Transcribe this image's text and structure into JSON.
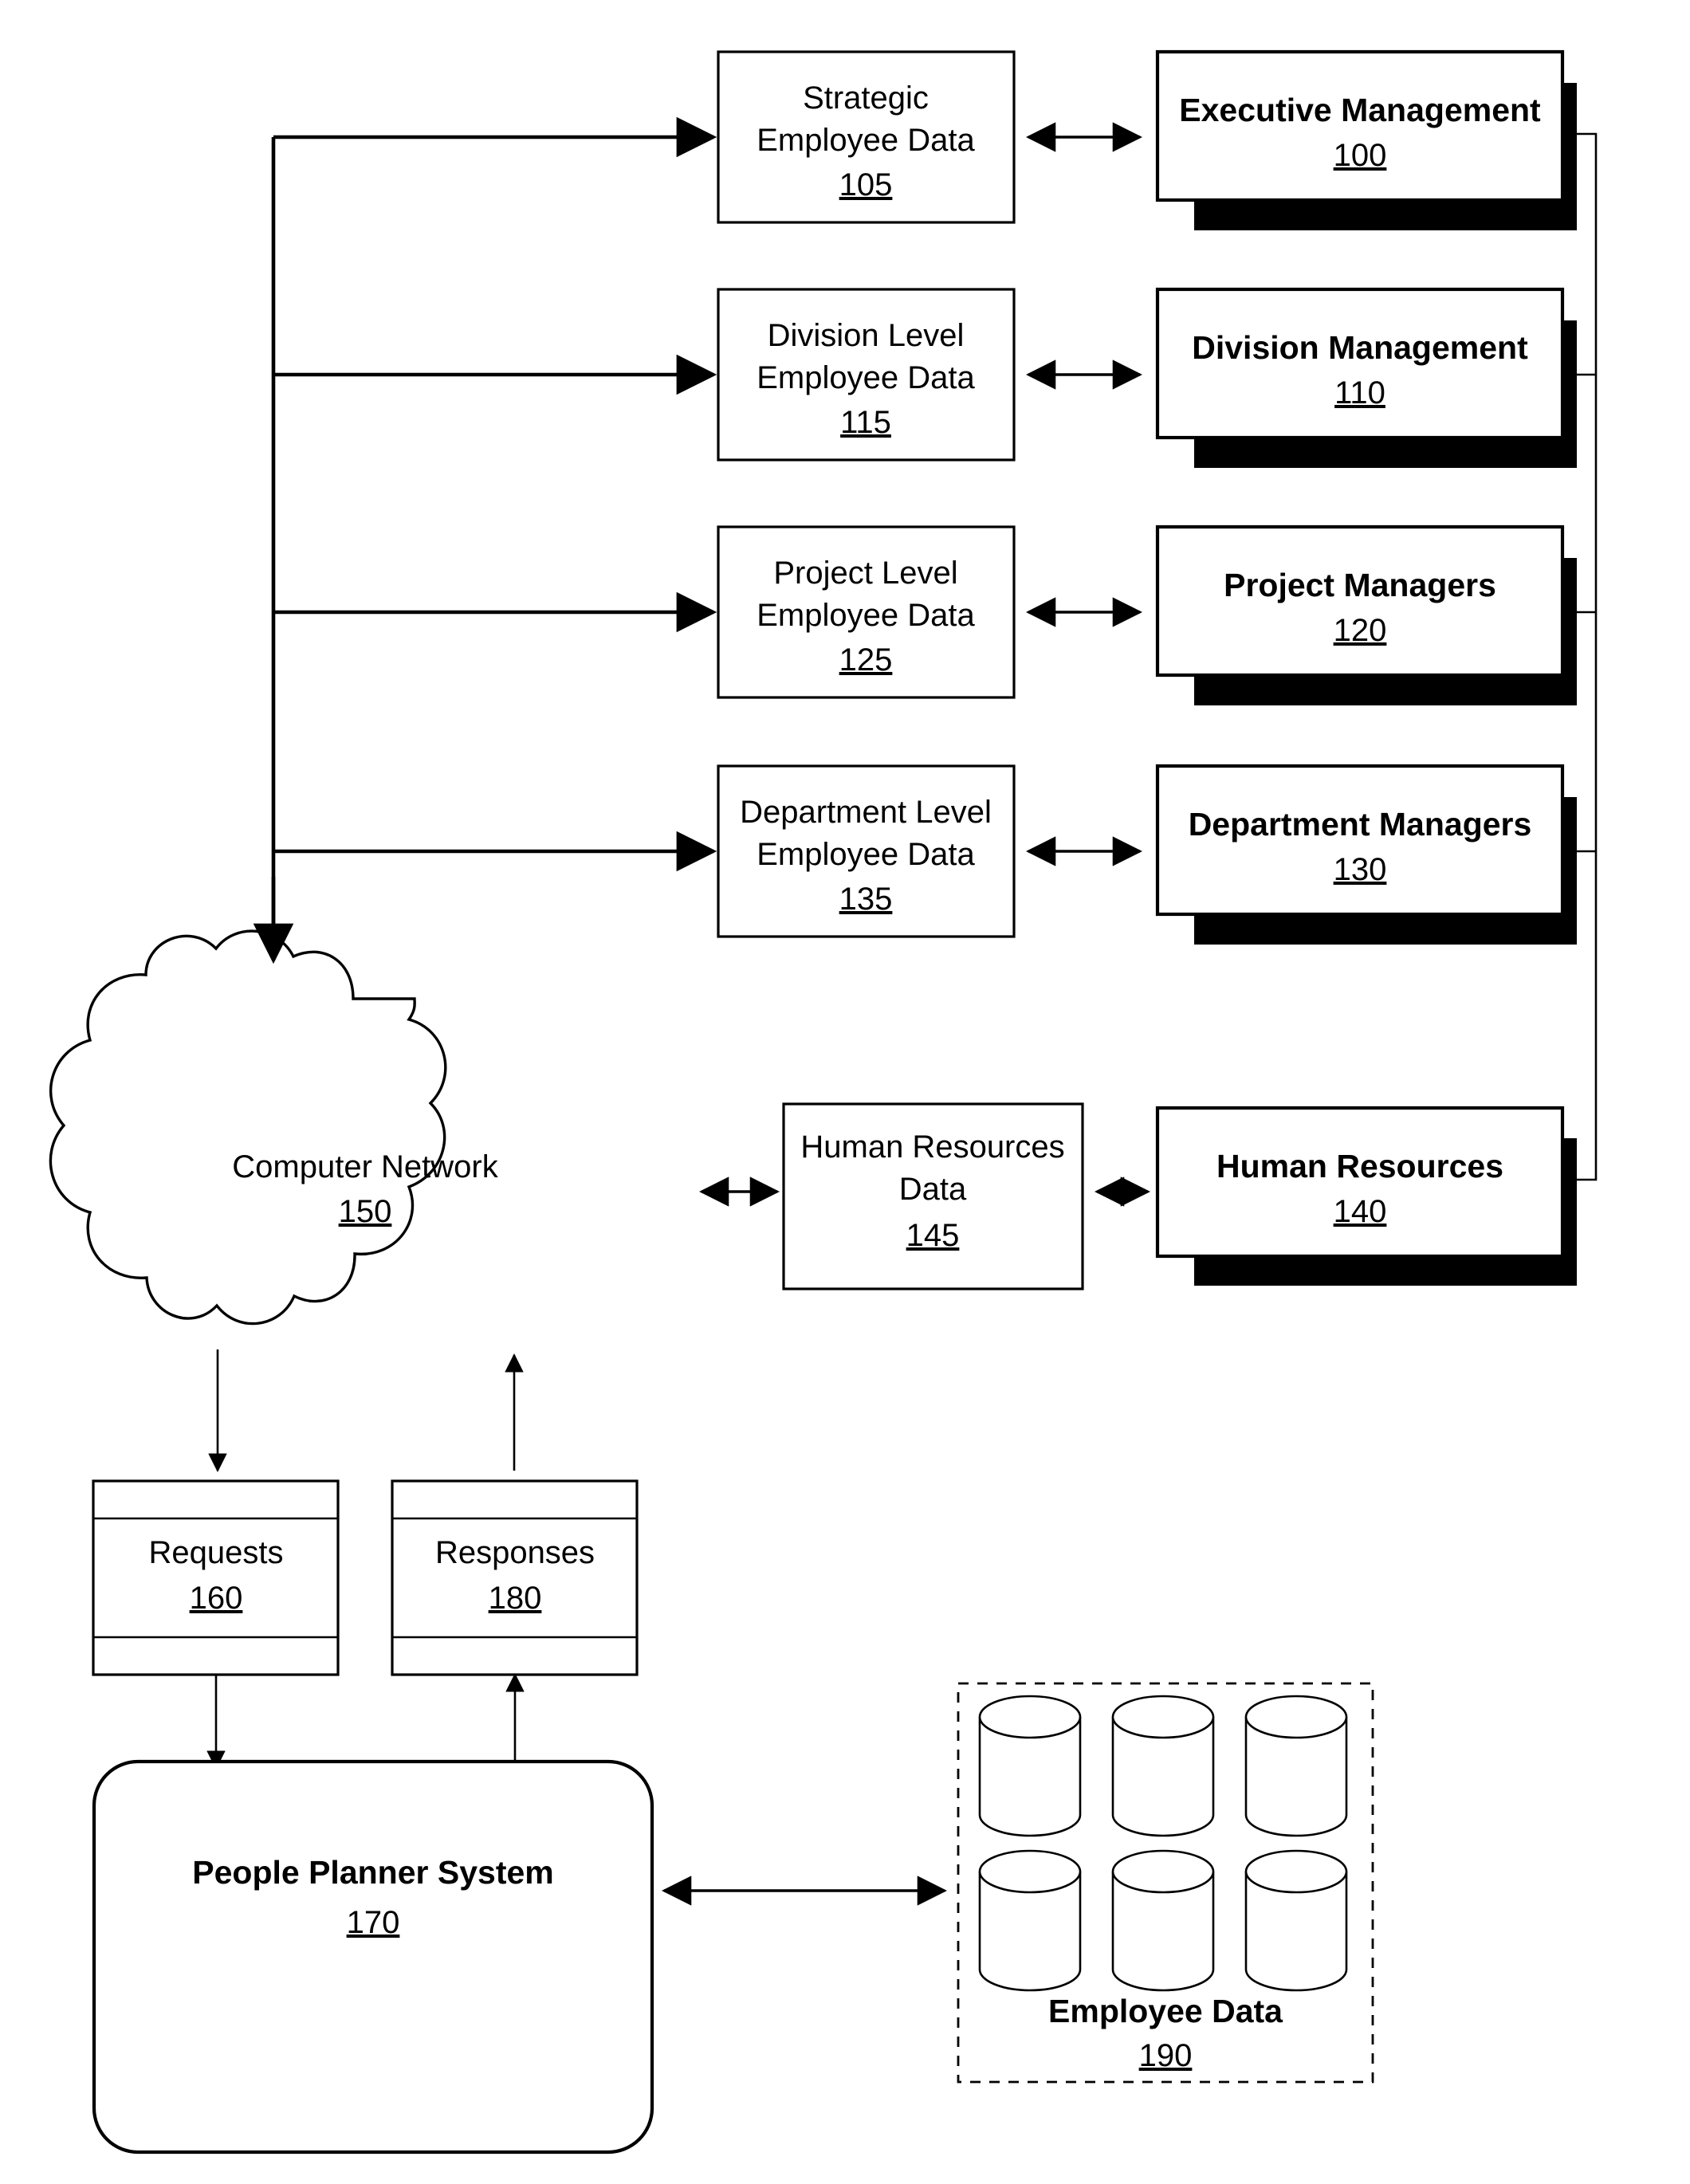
{
  "figure": {
    "title": "People Planner System block diagram",
    "line_color": "#000000",
    "fill_color": "#ffffff"
  },
  "data_boxes": [
    {
      "line1": "Strategic",
      "line2": "Employee Data",
      "ref": "105"
    },
    {
      "line1": "Division Level",
      "line2": "Employee Data",
      "ref": "115"
    },
    {
      "line1": "Project Level",
      "line2": "Employee Data",
      "ref": "125"
    },
    {
      "line1": "Department Level",
      "line2": "Employee Data",
      "ref": "135"
    },
    {
      "line1": "Human Resources",
      "line2": "Data",
      "ref": "145"
    }
  ],
  "actor_boxes": [
    {
      "label": "Executive Management",
      "ref": "100"
    },
    {
      "label": "Division Management",
      "ref": "110"
    },
    {
      "label": "Project Managers",
      "ref": "120"
    },
    {
      "label": "Department Managers",
      "ref": "130"
    },
    {
      "label": "Human Resources",
      "ref": "140"
    }
  ],
  "network": {
    "label": "Computer Network",
    "ref": "150"
  },
  "queues": [
    {
      "label": "Requests",
      "ref": "160"
    },
    {
      "label": "Responses",
      "ref": "180"
    }
  ],
  "system": {
    "label": "People Planner System",
    "ref": "170"
  },
  "database": {
    "label": "Employee Data",
    "ref": "190",
    "cylinder_count": 6
  }
}
